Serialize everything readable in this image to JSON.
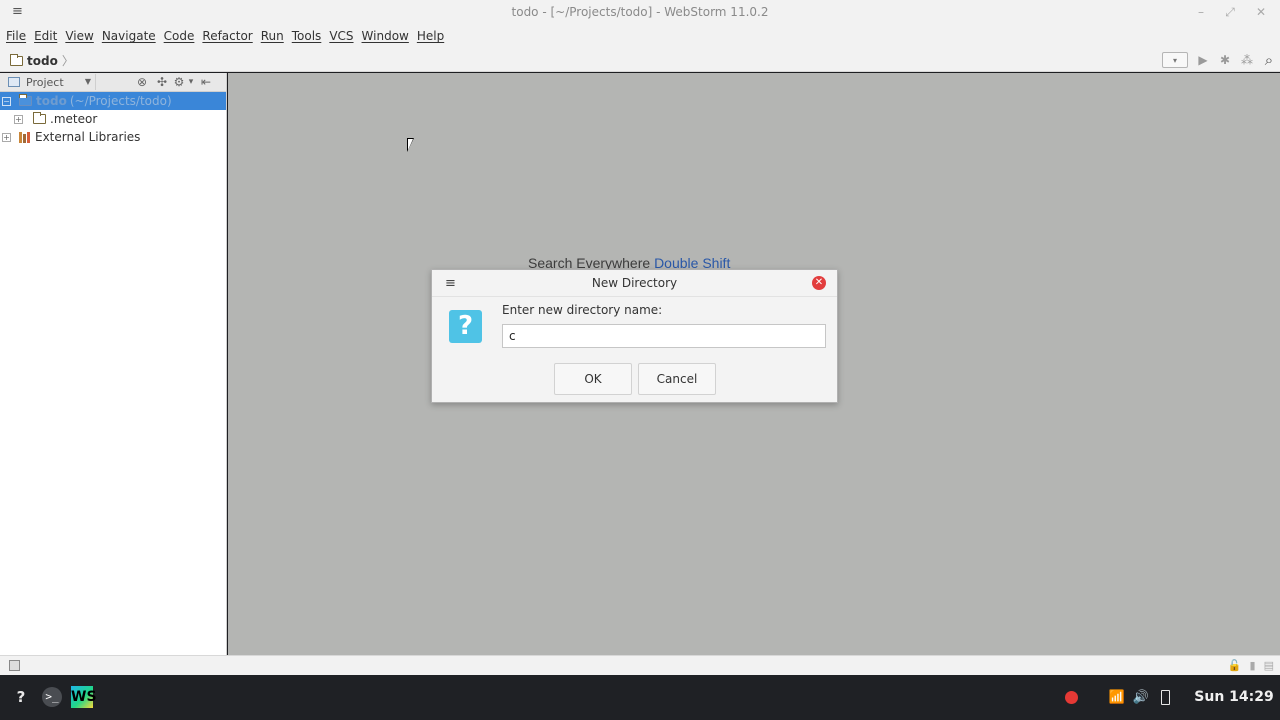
{
  "window": {
    "title": "todo - [~/Projects/todo] - WebStorm 11.0.2",
    "menu_icon": "hamburger-icon",
    "controls": {
      "minimize": "–",
      "restore": "⤢",
      "close": "✕"
    }
  },
  "menubar": {
    "items": [
      "File",
      "Edit",
      "View",
      "Navigate",
      "Code",
      "Refactor",
      "Run",
      "Tools",
      "VCS",
      "Window",
      "Help"
    ]
  },
  "navbar": {
    "breadcrumb": "todo",
    "chevron": "〉",
    "tools": {
      "run_config": "▾",
      "run": "▶",
      "debug": "✱",
      "coverage": "⁂",
      "search": "⌕"
    }
  },
  "project_panel": {
    "selector_label": "Project",
    "selector_caret": "▼",
    "tool_icons": {
      "collapse": "⊗",
      "scroll": "✣",
      "settings": "⚙",
      "settings_caret": "▾",
      "hide": "⇤"
    },
    "tree": [
      {
        "name": "todo",
        "path": "(~/Projects/todo)",
        "selected": true,
        "expander": "−"
      },
      {
        "name": ".meteor",
        "selected": false,
        "expander": "+"
      },
      {
        "name": "External Libraries",
        "selected": false,
        "expander": "+"
      }
    ]
  },
  "editor": {
    "hint_text": "Search Everywhere",
    "hint_shortcut": "Double Shift"
  },
  "dialog": {
    "title": "New Directory",
    "menu_icon": "≡",
    "close": "✕",
    "icon": "?",
    "label": "Enter new directory name:",
    "input_value": "c",
    "ok_label": "OK",
    "cancel_label": "Cancel"
  },
  "statusbar": {
    "right_icons": [
      "🔓",
      "▮",
      "▤"
    ]
  },
  "taskbar": {
    "help": "?",
    "terminal": ">_",
    "webstorm": "WS",
    "wifi": "📶",
    "volume": "🔊",
    "clock": "Sun 14:29"
  }
}
